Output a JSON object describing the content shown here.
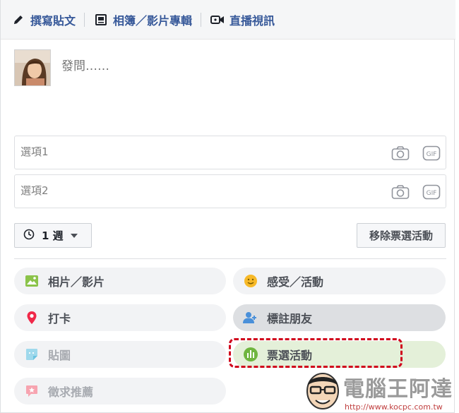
{
  "tabs": [
    {
      "label": "撰寫貼文",
      "icon": "pencil-icon"
    },
    {
      "label": "相簿／影片專輯",
      "icon": "album-icon"
    },
    {
      "label": "直播視訊",
      "icon": "video-camera-icon"
    }
  ],
  "composer": {
    "question_placeholder": "發問……"
  },
  "options": [
    {
      "placeholder": "選項1"
    },
    {
      "placeholder": "選項2"
    }
  ],
  "duration": {
    "label": "1 週"
  },
  "remove_poll": {
    "label": "移除票選活動"
  },
  "actions": [
    {
      "label": "相片／影片",
      "icon": "photo-icon",
      "color": "#8bc34a"
    },
    {
      "label": "感受／活動",
      "icon": "smiley-icon",
      "color": "#f7b928"
    },
    {
      "label": "打卡",
      "icon": "location-pin-icon",
      "color": "#f02849"
    },
    {
      "label": "標註朋友",
      "icon": "tag-friends-icon",
      "color": "#4a90d9"
    },
    {
      "label": "貼圖",
      "icon": "sticker-icon",
      "color": "#5bc0de"
    },
    {
      "label": "票選活動",
      "icon": "poll-icon",
      "color": "#6fb53f"
    },
    {
      "label": "徵求推薦",
      "icon": "recommendation-icon",
      "color": "#f25268"
    }
  ],
  "watermark": {
    "title": "電腦王阿達",
    "url": "http://www.kocpc.com.tw"
  }
}
